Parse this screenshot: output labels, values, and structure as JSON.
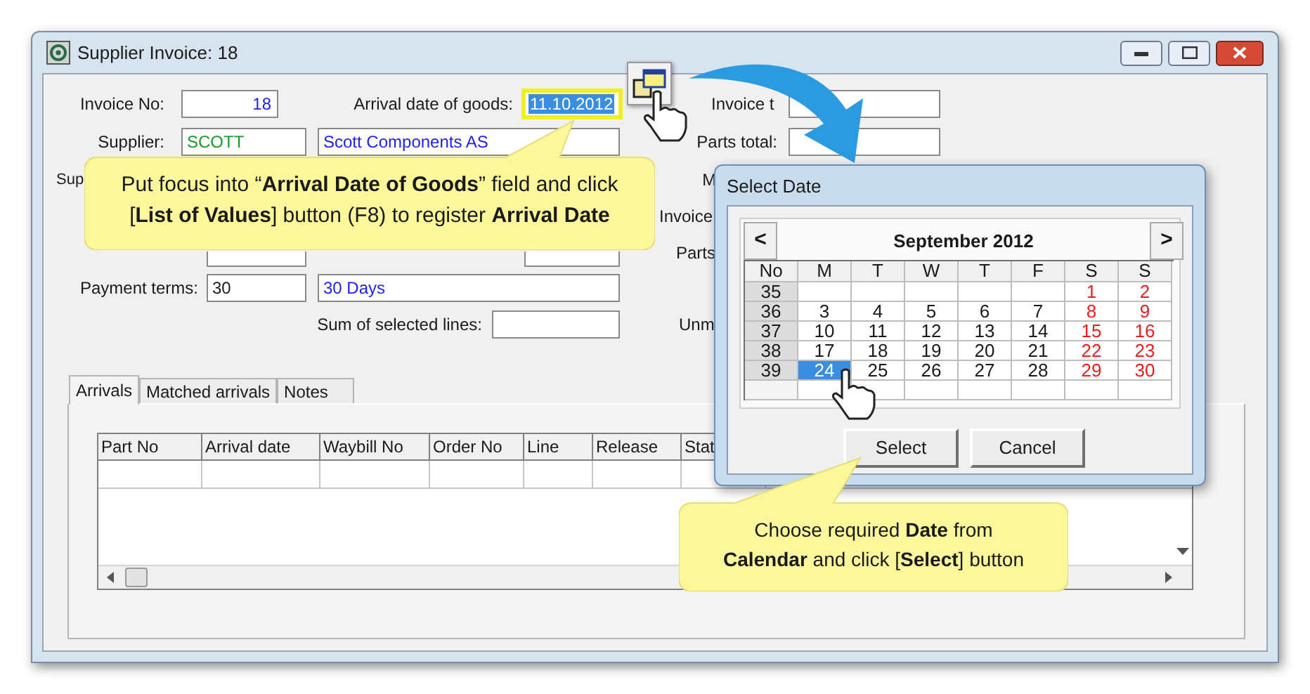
{
  "window": {
    "title": "Supplier Invoice: 18"
  },
  "form": {
    "invoice_no": {
      "label": "Invoice No:",
      "value": "18"
    },
    "arrival_date": {
      "label": "Arrival date of goods:",
      "value": "11.10.2012",
      "focused": true
    },
    "invoice_to": {
      "label": "Invoice t"
    },
    "supplier": {
      "label": "Supplier:",
      "code": "SCOTT",
      "name": "Scott Components AS"
    },
    "parts_total": {
      "label": "Parts total:"
    },
    "partial_labels": {
      "left": "Sup",
      "m": "M",
      "invoice": "Invoice",
      "parts": "Parts",
      "unm": "Unm"
    },
    "payment_terms": {
      "label": "Payment terms:",
      "code": "30",
      "name": "30 Days"
    },
    "sum_selected": {
      "label": "Sum of selected lines:"
    }
  },
  "tabs": [
    {
      "label": "Arrivals",
      "selected": true
    },
    {
      "label": "Matched arrivals",
      "selected": false
    },
    {
      "label": "Notes",
      "selected": false
    }
  ],
  "table": {
    "columns": [
      "Part No",
      "Arrival date",
      "Waybill No",
      "Order No",
      "Line",
      "Release",
      "Stat"
    ]
  },
  "dialog": {
    "title": "Select Date",
    "month": "September 2012",
    "prev": "<",
    "next": ">",
    "columns": [
      "No",
      "M",
      "T",
      "W",
      "T",
      "F",
      "S",
      "S"
    ],
    "weeks": [
      {
        "no": "35",
        "days": [
          {
            "text": "1",
            "selected": false
          },
          {
            "text": "2",
            "selected": false
          }
        ]
      },
      {
        "no": "36",
        "days": [
          {
            "text": "3",
            "selected": false
          },
          {
            "text": "4",
            "selected": false
          },
          {
            "text": "5",
            "selected": false
          },
          {
            "text": "6",
            "selected": false
          },
          {
            "text": "7",
            "selected": false
          },
          {
            "text": "8",
            "selected": false
          },
          {
            "text": "9",
            "selected": false
          }
        ]
      },
      {
        "no": "37",
        "days": [
          {
            "text": "10",
            "selected": false
          },
          {
            "text": "11",
            "selected": false
          },
          {
            "text": "12",
            "selected": false
          },
          {
            "text": "13",
            "selected": false
          },
          {
            "text": "14",
            "selected": false
          },
          {
            "text": "15",
            "selected": false
          },
          {
            "text": "16",
            "selected": false
          }
        ]
      },
      {
        "no": "38",
        "days": [
          {
            "text": "17",
            "selected": false
          },
          {
            "text": "18",
            "selected": false
          },
          {
            "text": "19",
            "selected": false
          },
          {
            "text": "20",
            "selected": false
          },
          {
            "text": "21",
            "selected": false
          },
          {
            "text": "22",
            "selected": false
          },
          {
            "text": "23",
            "selected": false
          }
        ]
      },
      {
        "no": "39",
        "days": [
          {
            "text": "24",
            "selected": true
          },
          {
            "text": "25",
            "selected": false
          },
          {
            "text": "26",
            "selected": false
          },
          {
            "text": "27",
            "selected": false
          },
          {
            "text": "28",
            "selected": false
          },
          {
            "text": "29",
            "selected": false
          },
          {
            "text": "30",
            "selected": false
          }
        ]
      }
    ],
    "buttons": [
      "Select",
      "Cancel"
    ]
  },
  "callouts": [
    {
      "lines": [
        "Put focus into “**Arrival Date of Goods**” field and click",
        "[**List of Values**] button (F8) to register **Arrival Date**"
      ]
    },
    {
      "lines": [
        "Choose required **Date** from",
        "**Calendar** and click [**Select**] button"
      ]
    }
  ]
}
